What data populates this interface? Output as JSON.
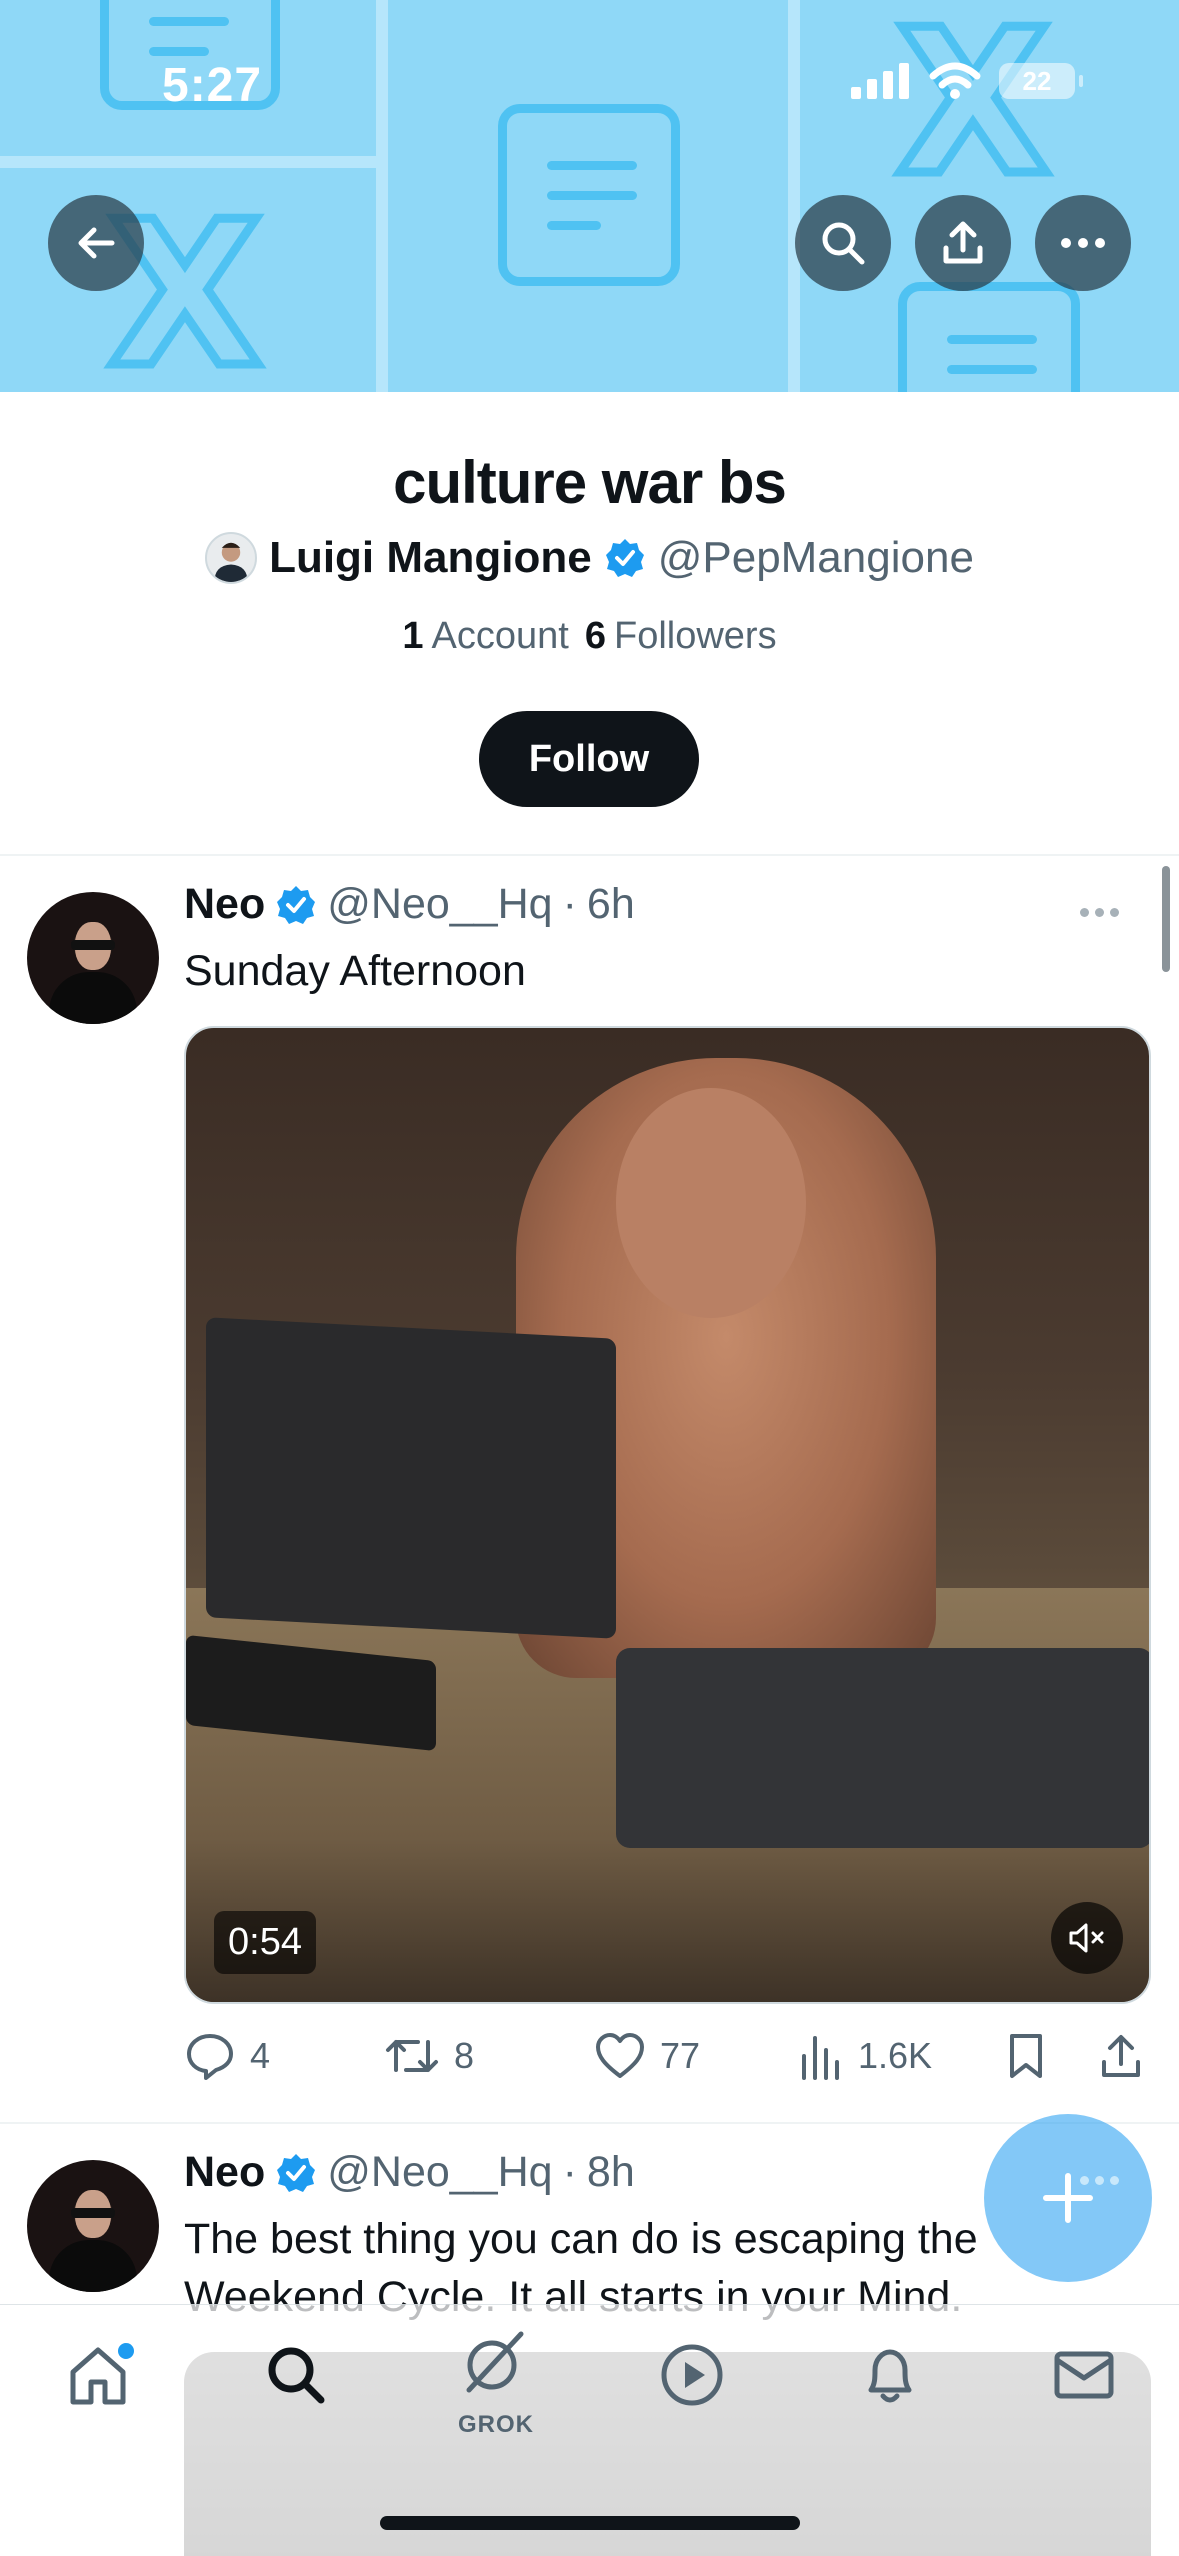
{
  "status_bar": {
    "time": "5:27",
    "battery": "22"
  },
  "header_actions": {
    "back": "back-arrow-icon",
    "search": "search-icon",
    "share": "share-icon",
    "more": "more-icon"
  },
  "list": {
    "title": "culture war bs",
    "owner_name": "Luigi Mangione",
    "owner_handle": "@PepMangione",
    "account_count": "1",
    "account_label": "Account",
    "follower_count": "6",
    "follower_label": "Followers",
    "follow_label": "Follow"
  },
  "tweets": [
    {
      "name": "Neo",
      "handle": "@Neo__Hq",
      "separator": "·",
      "time": "6h",
      "text": "Sunday Afternoon",
      "video_duration": "0:54",
      "replies": "4",
      "reposts": "8",
      "likes": "77",
      "views": "1.6K"
    },
    {
      "name": "Neo",
      "handle": "@Neo__Hq",
      "separator": "·",
      "time": "8h",
      "text": "The best thing you can do is escaping the Weekend Cycle. It all starts in your Mind."
    }
  ],
  "tabbar": {
    "grok_label": "GROK"
  },
  "colors": {
    "accent": "#1d9bf0",
    "banner": "#8fd8f7",
    "text": "#0f1419",
    "muted": "#536471"
  }
}
